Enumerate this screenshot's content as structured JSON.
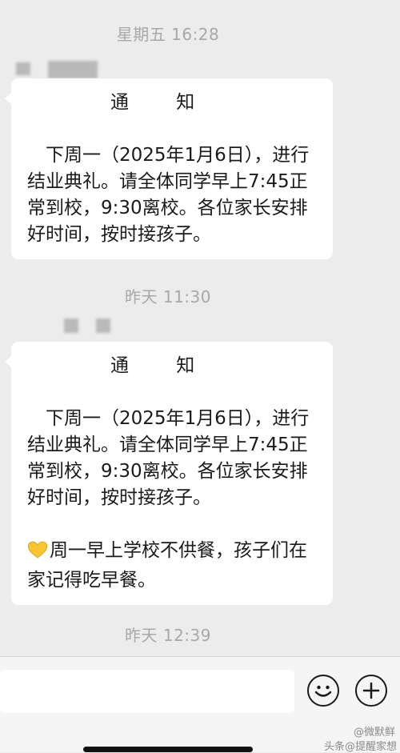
{
  "chat": {
    "messages": [
      {
        "timestamp": "星期五 16:28",
        "title": "通 知",
        "body": "下周一（2025年1月6日），进行结业典礼。请全体同学早上7:45正常到校，9:30离校。各位家长安排好时间，按时接孩子。"
      },
      {
        "timestamp": "昨天 11:30",
        "title": "通 知",
        "body": "下周一（2025年1月6日），进行结业典礼。请全体同学早上7:45正常到校，9:30离校。各位家长安排好时间，按时接孩子。",
        "note": "周一早上学校不供餐，孩子们在家记得吃早餐。",
        "note_icon": "yellow-heart-icon"
      }
    ],
    "last_timestamp": "昨天 12:39"
  },
  "input_bar": {
    "message_value": "",
    "emoji_icon": "emoji-face-icon",
    "add_icon": "plus-circle-icon"
  },
  "watermark": {
    "line1": "@微默鲜",
    "line2": "头条@提醒家想"
  },
  "colors": {
    "chat_background": "#ececec",
    "bubble": "#ffffff",
    "timestamp_text": "#a8a8a8",
    "heart": "#f7c531"
  }
}
